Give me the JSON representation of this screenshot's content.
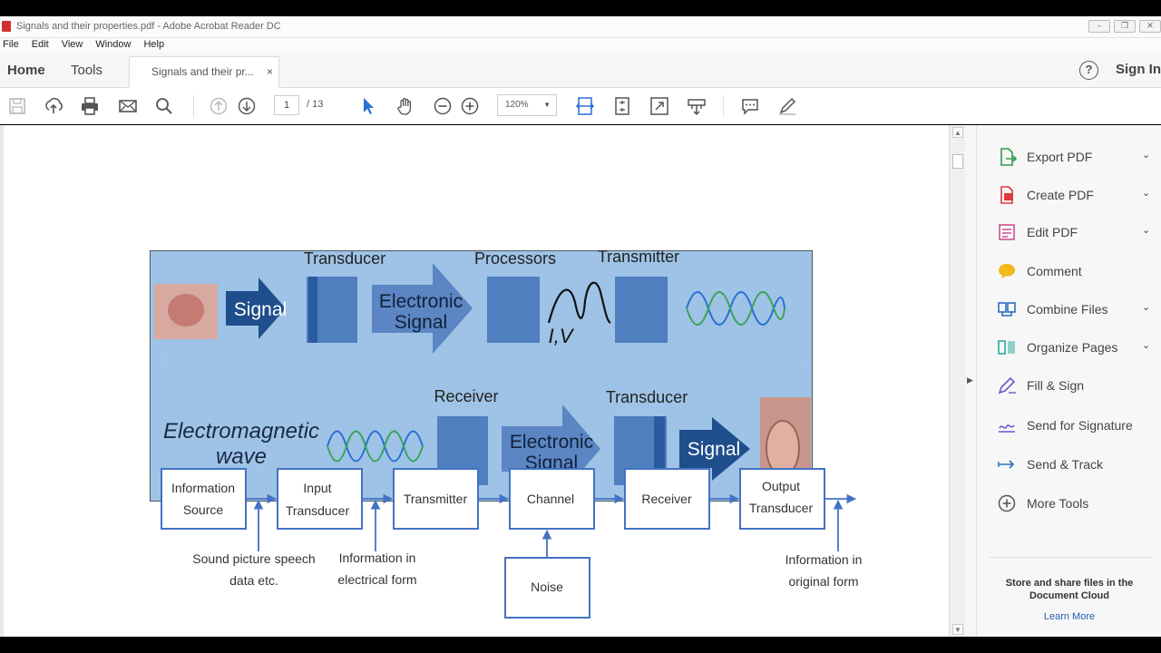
{
  "window": {
    "title": "Signals and their properties.pdf - Adobe Acrobat Reader DC",
    "min_glyph": "–",
    "max_glyph": "❐",
    "close_glyph": "✕"
  },
  "menu": [
    "File",
    "Edit",
    "View",
    "Window",
    "Help"
  ],
  "tabs": {
    "home": "Home",
    "tools": "Tools",
    "document": "Signals and their pr...",
    "close": "×"
  },
  "header": {
    "help": "?",
    "signin": "Sign In"
  },
  "toolbar": {
    "page_current": "1",
    "page_total": "/ 13",
    "zoom": "120%",
    "zoom_caret": "▼",
    "icons": [
      "save-icon",
      "upload-icon",
      "print-icon",
      "email-icon",
      "search-icon",
      "page-up-icon",
      "page-down-icon",
      "select-arrow-icon",
      "hand-icon",
      "zoom-out-icon",
      "zoom-in-icon",
      "fit-width-icon",
      "fit-page-icon",
      "full-screen-icon",
      "read-mode-icon",
      "comment-icon",
      "pen-icon"
    ]
  },
  "scroll": {
    "up": "▲",
    "down": "▼",
    "panel_toggle": "▶"
  },
  "right_panel": {
    "items": [
      {
        "label": "Export PDF",
        "icon": "export-pdf-icon",
        "expandable": true,
        "color": "#2e9d4b"
      },
      {
        "label": "Create PDF",
        "icon": "create-pdf-icon",
        "expandable": true,
        "color": "#e0383e"
      },
      {
        "label": "Edit PDF",
        "icon": "edit-pdf-icon",
        "expandable": true,
        "color": "#d0508f"
      },
      {
        "label": "Comment",
        "icon": "comment-icon",
        "expandable": false,
        "color": "#f2b91c"
      },
      {
        "label": "Combine Files",
        "icon": "combine-files-icon",
        "expandable": true,
        "color": "#2a6fc4"
      },
      {
        "label": "Organize Pages",
        "icon": "organize-pages-icon",
        "expandable": true,
        "color": "#2aa9a0"
      },
      {
        "label": "Fill & Sign",
        "icon": "fill-sign-icon",
        "expandable": false,
        "color": "#6f54c6"
      },
      {
        "label": "Send for Signature",
        "icon": "send-signature-icon",
        "expandable": false,
        "color": "#6f54c6"
      },
      {
        "label": "Send & Track",
        "icon": "send-track-icon",
        "expandable": false,
        "color": "#2a6fc4"
      },
      {
        "label": "More Tools",
        "icon": "more-tools-icon",
        "expandable": false,
        "color": "#555555"
      }
    ],
    "chevron": "⌄",
    "cloud_text_1": "Store and share files in the",
    "cloud_text_2": "Document Cloud",
    "learn_more": "Learn More"
  },
  "slide": {
    "top_row": {
      "transducer": "Transducer",
      "processors": "Processors",
      "transmitter": "Transmitter",
      "signal_arrow": "Signal",
      "electronic_1": "Electronic",
      "electronic_2": "Signal",
      "iv_label": "I,V"
    },
    "bottom_row": {
      "em_1": "Electromagnetic",
      "em_2": "wave",
      "receiver": "Receiver",
      "transducer": "Transducer",
      "electronic_1": "Electronic",
      "electronic_2": "Signal",
      "signal_arrow": "Signal"
    },
    "nav_prev": "‹",
    "nav_next": "›",
    "colors": {
      "background": "#9ec3e6",
      "arrow": "#1f4e8c",
      "block": "#4f7fbf",
      "light_arrow": "#5b86c3"
    }
  },
  "block_diagram": {
    "blocks": [
      {
        "line1": "Information",
        "line2": "Source"
      },
      {
        "line1": "Input",
        "line2": "Transducer"
      },
      {
        "line1": "Transmitter",
        "line2": ""
      },
      {
        "line1": "Channel",
        "line2": ""
      },
      {
        "line1": "Receiver",
        "line2": ""
      },
      {
        "line1": "Output",
        "line2": "Transducer"
      }
    ],
    "noise": "Noise",
    "captions": {
      "source_1": "Sound picture speech",
      "source_2": "data etc.",
      "input_1": "Information in",
      "input_2": "electrical form",
      "output_1": "Information in",
      "output_2": "original form"
    },
    "colors": {
      "border": "#4472c4",
      "arrow": "#4472c4"
    }
  }
}
